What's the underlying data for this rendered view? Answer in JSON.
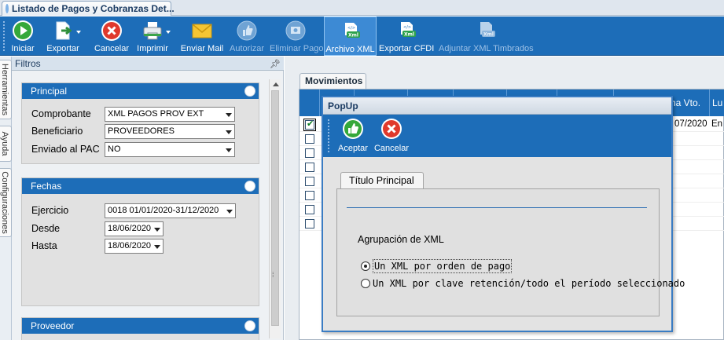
{
  "window_tab": {
    "title": "Listado de Pagos y Cobranzas Det..."
  },
  "ribbon": {
    "buttons": [
      {
        "label": "Iniciar",
        "icon": "play-icon",
        "color": "#33a532"
      },
      {
        "label": "Exportar",
        "icon": "export-icon"
      },
      {
        "label": "Cancelar",
        "icon": "cancel-icon",
        "color": "#e03a2e"
      },
      {
        "label": "Imprimir",
        "icon": "printer-icon"
      },
      {
        "label": "Enviar Mail",
        "icon": "mail-icon",
        "color": "#f1c232"
      },
      {
        "label": "Autorizar",
        "icon": "thumbs-up-icon",
        "disabled": true
      },
      {
        "label": "Eliminar Pago",
        "icon": "delete-payment-icon",
        "disabled": true
      },
      {
        "label": "Archivo XML",
        "icon": "xml-file-icon",
        "active": true
      },
      {
        "label": "Exportar CFDI",
        "icon": "xml-export-icon"
      },
      {
        "label": "Adjuntar XML Timbrados",
        "icon": "xml-attach-icon",
        "disabled": true
      }
    ]
  },
  "side_tabs": [
    "Herramientas",
    "Ayuda",
    "Configuraciones"
  ],
  "filters": {
    "title": "Filtros",
    "principal": {
      "title": "Principal",
      "comprobante": {
        "label": "Comprobante",
        "value": "XML PAGOS PROV EXT"
      },
      "beneficiario": {
        "label": "Beneficiario",
        "value": "PROVEEDORES"
      },
      "enviado": {
        "label": "Enviado al PAC",
        "value": "NO"
      }
    },
    "fechas": {
      "title": "Fechas",
      "ejercicio": {
        "label": "Ejercicio",
        "value": "0018 01/01/2020-31/12/2020"
      },
      "desde": {
        "label": "Desde",
        "value": "18/06/2020"
      },
      "hasta": {
        "label": "Hasta",
        "value": "18/06/2020"
      }
    },
    "proveedor": {
      "title": "Proveedor"
    }
  },
  "movimientos": {
    "tab": "Movimientos",
    "columns": [
      "",
      "",
      "",
      "",
      "",
      "",
      "",
      "cha Vto.",
      "Lu"
    ],
    "first_row": {
      "fecha": "07/2020",
      "lugar": "En"
    }
  },
  "popup": {
    "title": "PopUp",
    "accept": "Aceptar",
    "cancel": "Cancelar",
    "tab": "Título Principal",
    "group_label": "Agrupación de XML",
    "options": [
      "Un XML por orden de pago",
      "Un XML por clave retención/todo el período seleccionado"
    ],
    "selected_index": 0
  }
}
